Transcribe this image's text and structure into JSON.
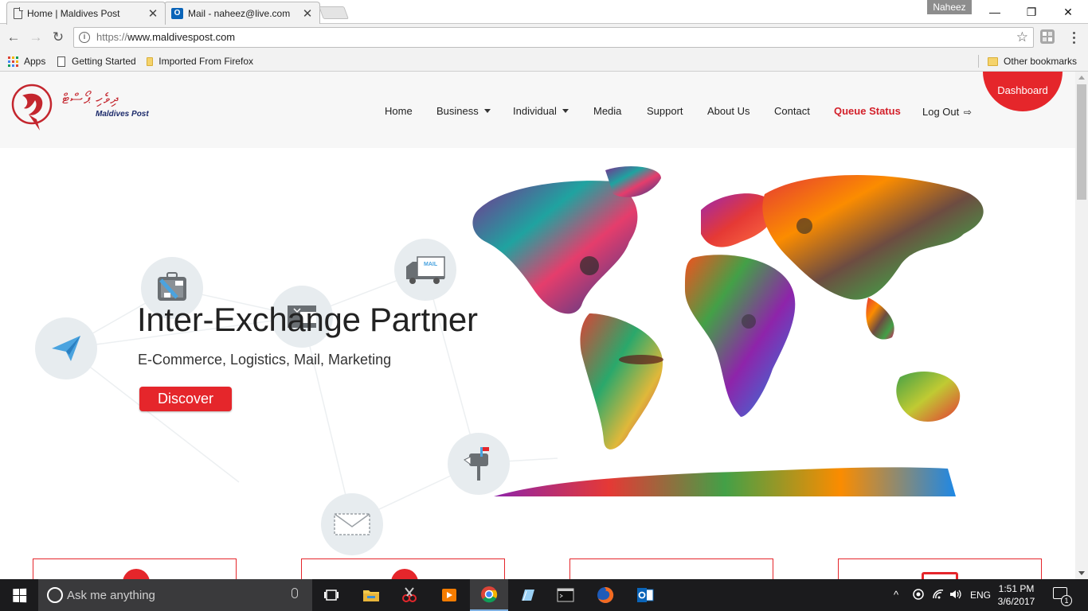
{
  "browser": {
    "tabs": [
      {
        "title": "Home | Maldives Post",
        "close": "✕"
      },
      {
        "title": "Mail - naheez@live.com",
        "close": "✕"
      }
    ],
    "outlook_glyph": "O",
    "user": "Naheez",
    "window_controls": {
      "minimize": "—",
      "maximize": "❐",
      "close": "✕"
    },
    "url_scheme": "https://",
    "url_host": "www.maldivespost.com",
    "nav": {
      "back": "←",
      "forward": "→",
      "reload": "↻"
    },
    "info_glyph": "i",
    "star": "☆",
    "bookmarks": {
      "apps": "Apps",
      "getting_started": "Getting Started",
      "imported": "Imported From Firefox",
      "other": "Other bookmarks"
    },
    "apps_colors": [
      "#db4437",
      "#f4b400",
      "#0f9d58",
      "#4285f4",
      "#db4437",
      "#f4b400",
      "#0f9d58",
      "#4285f4",
      "#db4437"
    ]
  },
  "site": {
    "logo": {
      "dhivehi": "ދިވެހި ޕޯސްޓް",
      "text": "Maldives Post"
    },
    "nav": {
      "home": "Home",
      "business": "Business",
      "individual": "Individual",
      "media": "Media",
      "support": "Support",
      "about": "About Us",
      "contact": "Contact",
      "queue": "Queue Status",
      "logout": "Log Out",
      "logout_icon": "⇨"
    },
    "dashboard": "Dashboard",
    "hero": {
      "title": "Inter-Exchange Partner",
      "subtitle": "E-Commerce, Logistics, Mail, Marketing",
      "cta": "Discover",
      "mail_label": "MAIL"
    },
    "colors": {
      "accent": "#e5262b",
      "icon_bg": "#e7ecef",
      "navy": "#1d2b6b"
    }
  },
  "taskbar": {
    "search_placeholder": "Ask me anything",
    "tray": {
      "language": "ENG",
      "caret": "^"
    },
    "time": "1:51 PM",
    "date": "3/6/2017",
    "notifications": "1"
  }
}
